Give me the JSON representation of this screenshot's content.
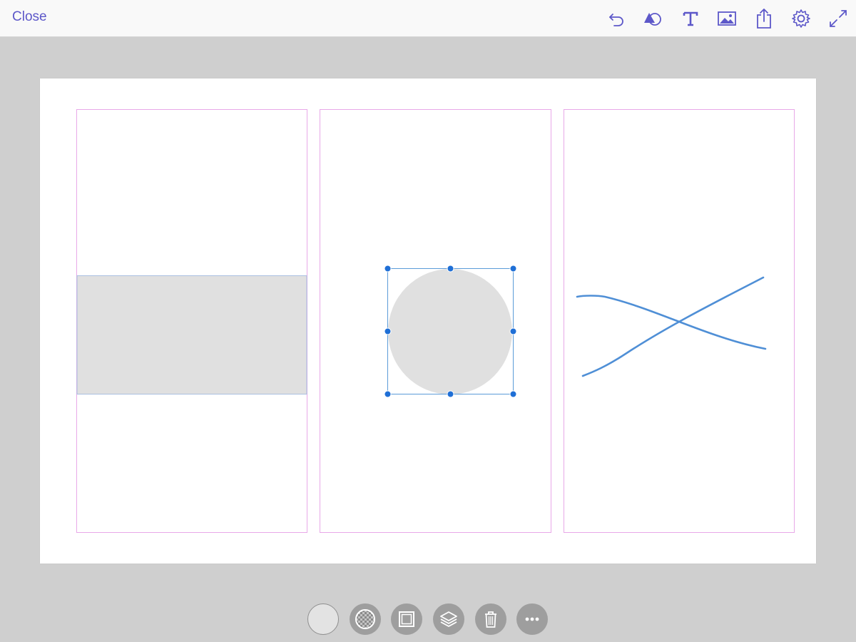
{
  "header": {
    "close_label": "Close"
  },
  "toolbar": {
    "tools": [
      {
        "name": "undo-icon"
      },
      {
        "name": "shapes-icon"
      },
      {
        "name": "text-icon"
      },
      {
        "name": "image-icon"
      },
      {
        "name": "share-icon"
      },
      {
        "name": "settings-icon"
      },
      {
        "name": "fullscreen-icon"
      }
    ]
  },
  "colors": {
    "accent": "#5d58c9",
    "selection": "#1f6fd6",
    "artboard_guide": "#e8a8e8",
    "shape_fill": "#e0e0e0",
    "stroke_line": "#4f8fd6",
    "canvas_bg": "#cfcfcf"
  },
  "canvas": {
    "artboards": [
      "artboard-1",
      "artboard-2",
      "artboard-3"
    ],
    "selected_shape": "circle"
  },
  "bottom_toolbar": {
    "buttons": [
      {
        "name": "fill-color-button"
      },
      {
        "name": "opacity-button"
      },
      {
        "name": "stroke-button"
      },
      {
        "name": "layers-button"
      },
      {
        "name": "delete-button"
      },
      {
        "name": "more-button"
      }
    ]
  }
}
